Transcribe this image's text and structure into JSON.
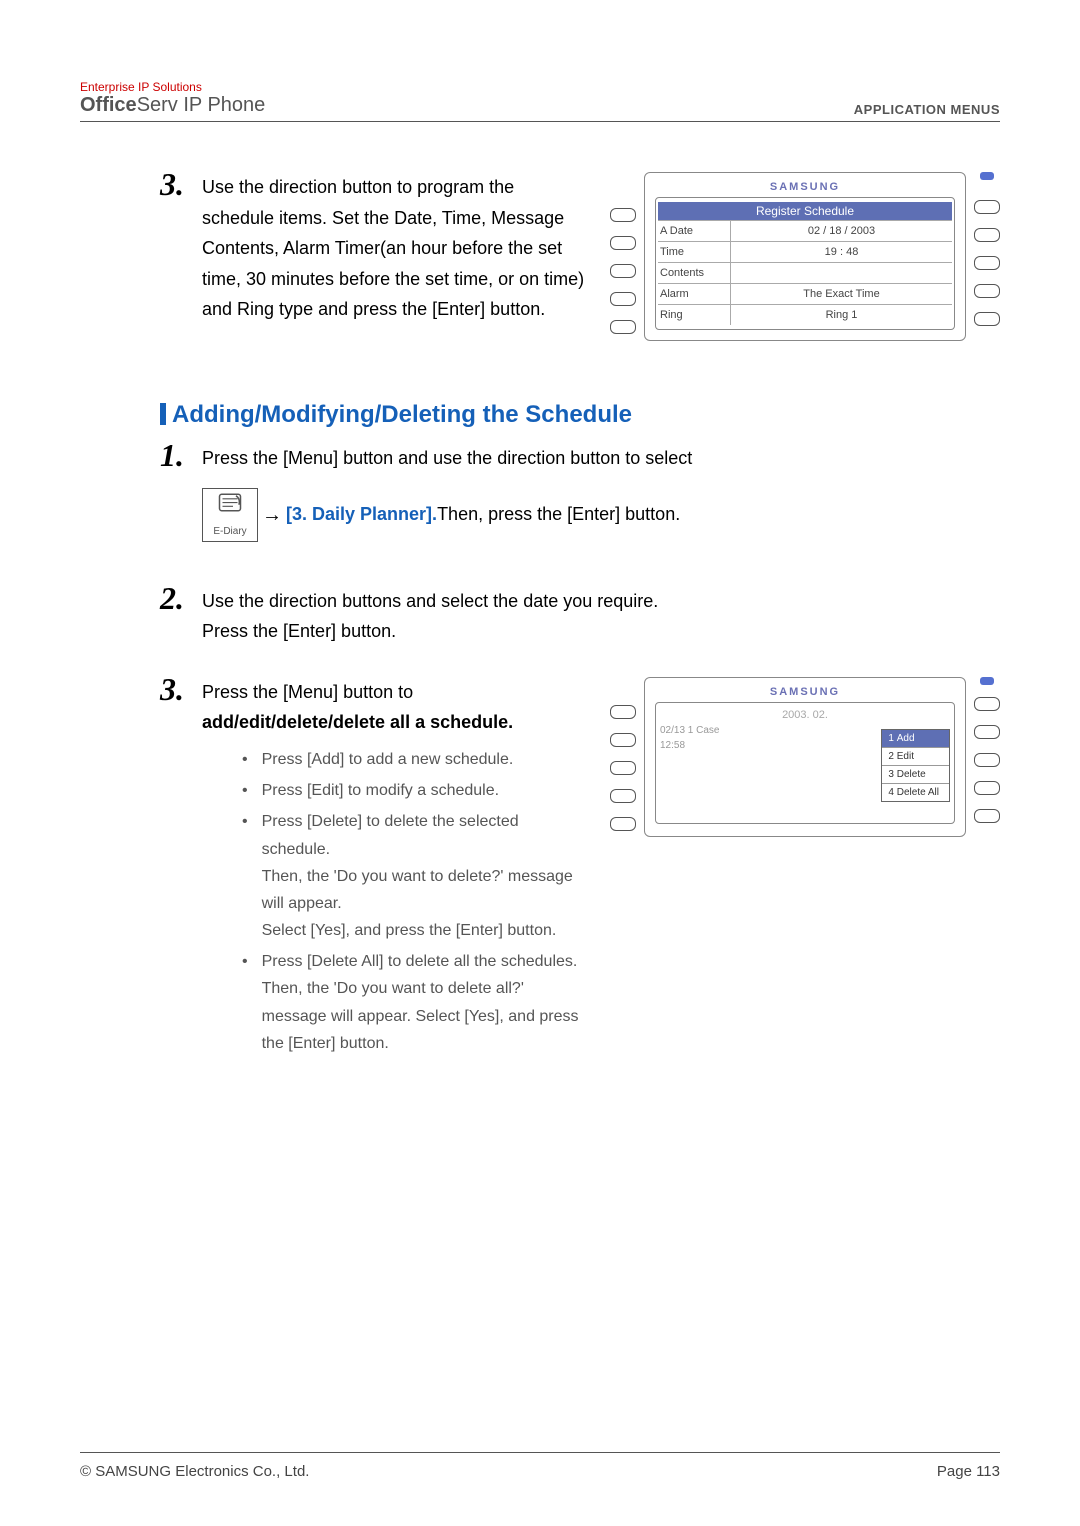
{
  "header": {
    "brand_line": "Enterprise IP Solutions",
    "product_bold": "Office",
    "product_mid": "Serv",
    "product_tail": " IP Phone",
    "right": "APPLICATION MENUS"
  },
  "step3_top": "Use the direction button to program the schedule items. Set the Date, Time, Message Contents, Alarm Timer(an hour before the set time, 30 minutes before the set time, or on time) and Ring type and press the [Enter] button.",
  "phone1": {
    "brand": "SAMSUNG",
    "title": "Register Schedule",
    "rows": [
      {
        "label": "A Date",
        "value": "02 / 18 / 2003"
      },
      {
        "label": "Time",
        "value": "19 : 48"
      },
      {
        "label": "Contents",
        "value": ""
      },
      {
        "label": "Alarm",
        "value": "The Exact Time"
      },
      {
        "label": "Ring",
        "value": "Ring 1"
      }
    ]
  },
  "section_heading": "Adding/Modifying/Deleting the Schedule",
  "step1": {
    "line": "Press the [Menu] button and use the direction button to select",
    "icon_label": "E-Diary",
    "planner": "[3. Daily Planner].",
    "after": "  Then, press the [Enter] button."
  },
  "step2": {
    "l1": "Use the direction buttons and select the date you require.",
    "l2": "Press the [Enter] button."
  },
  "step3": {
    "lead1": "Press the [Menu] button to",
    "lead2": "add/edit/delete/delete all a schedule.",
    "b1": "Press [Add] to add a new schedule.",
    "b2": "Press [Edit] to modify a schedule.",
    "b3a": "Press [Delete] to delete the selected schedule.",
    "b3b": "Then, the 'Do you want to delete?' message will appear.",
    "b3c": "Select [Yes], and press the [Enter] button.",
    "b4a": "Press [Delete All] to delete all the schedules.",
    "b4b": "Then, the 'Do you want to delete all?' message will appear. Select [Yes], and press the [Enter] button."
  },
  "phone2": {
    "brand": "SAMSUNG",
    "year_row": "2003. 02.",
    "dim1": "02/13   1 Case",
    "dim2": "12:58",
    "menu": [
      {
        "n": "1",
        "label": "Add"
      },
      {
        "n": "2",
        "label": "Edit"
      },
      {
        "n": "3",
        "label": "Delete"
      },
      {
        "n": "4",
        "label": "Delete All"
      }
    ]
  },
  "footer": {
    "left": "© SAMSUNG Electronics Co., Ltd.",
    "right": "Page 113"
  }
}
